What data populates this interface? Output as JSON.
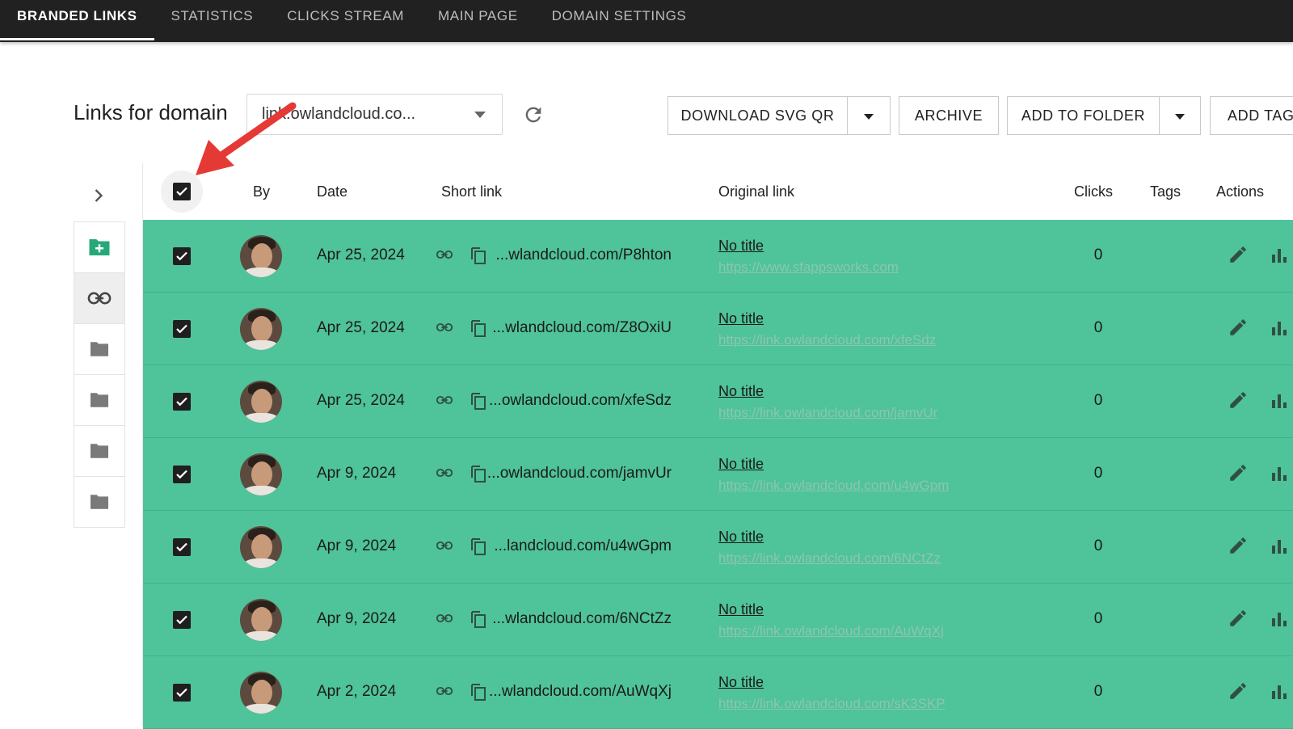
{
  "nav": {
    "tabs": [
      {
        "label": "BRANDED LINKS",
        "active": true
      },
      {
        "label": "STATISTICS",
        "active": false
      },
      {
        "label": "CLICKS STREAM",
        "active": false
      },
      {
        "label": "MAIN PAGE",
        "active": false
      },
      {
        "label": "DOMAIN SETTINGS",
        "active": false
      }
    ]
  },
  "toolbar": {
    "domain_label": "Links for domain",
    "domain_value": "link.owlandcloud.co...",
    "download_svg_qr": "DOWNLOAD SVG QR",
    "archive": "ARCHIVE",
    "add_to_folder": "ADD TO FOLDER",
    "add_tag": "ADD TAG"
  },
  "table": {
    "headers": {
      "by": "By",
      "date": "Date",
      "short_link": "Short link",
      "original_link": "Original link",
      "clicks": "Clicks",
      "tags": "Tags",
      "actions": "Actions"
    },
    "select_all_checked": true,
    "rows": [
      {
        "date": "Apr 25, 2024",
        "short": "...wlandcloud.com/P8hton",
        "title": "No title",
        "url": "https://www.sfappsworks.com",
        "clicks": "0",
        "checked": true
      },
      {
        "date": "Apr 25, 2024",
        "short": "...wlandcloud.com/Z8OxiU",
        "title": "No title",
        "url": "https://link.owlandcloud.com/xfeSdz",
        "clicks": "0",
        "checked": true
      },
      {
        "date": "Apr 25, 2024",
        "short": "...owlandcloud.com/xfeSdz",
        "title": "No title",
        "url": "https://link.owlandcloud.com/jamvUr",
        "clicks": "0",
        "checked": true
      },
      {
        "date": "Apr 9, 2024",
        "short": "...owlandcloud.com/jamvUr",
        "title": "No title",
        "url": "https://link.owlandcloud.com/u4wGpm",
        "clicks": "0",
        "checked": true
      },
      {
        "date": "Apr 9, 2024",
        "short": "...landcloud.com/u4wGpm",
        "title": "No title",
        "url": "https://link.owlandcloud.com/6NCtZz",
        "clicks": "0",
        "checked": true
      },
      {
        "date": "Apr 9, 2024",
        "short": "...wlandcloud.com/6NCtZz",
        "title": "No title",
        "url": "https://link.owlandcloud.com/AuWqXj",
        "clicks": "0",
        "checked": true
      },
      {
        "date": "Apr 2, 2024",
        "short": "...wlandcloud.com/AuWqXj",
        "title": "No title",
        "url": "https://link.owlandcloud.com/sK3SKP",
        "clicks": "0",
        "checked": true
      }
    ]
  },
  "sidebar": {
    "items": [
      {
        "icon": "add-folder-icon"
      },
      {
        "icon": "link-icon",
        "active": true
      },
      {
        "icon": "folder-icon"
      },
      {
        "icon": "folder-icon"
      },
      {
        "icon": "folder-icon"
      },
      {
        "icon": "folder-icon"
      }
    ]
  },
  "colors": {
    "row_selected": "#4fc39a",
    "nav_bg": "#212121",
    "accent_green": "#27a878",
    "annotation_arrow": "#e53935"
  }
}
